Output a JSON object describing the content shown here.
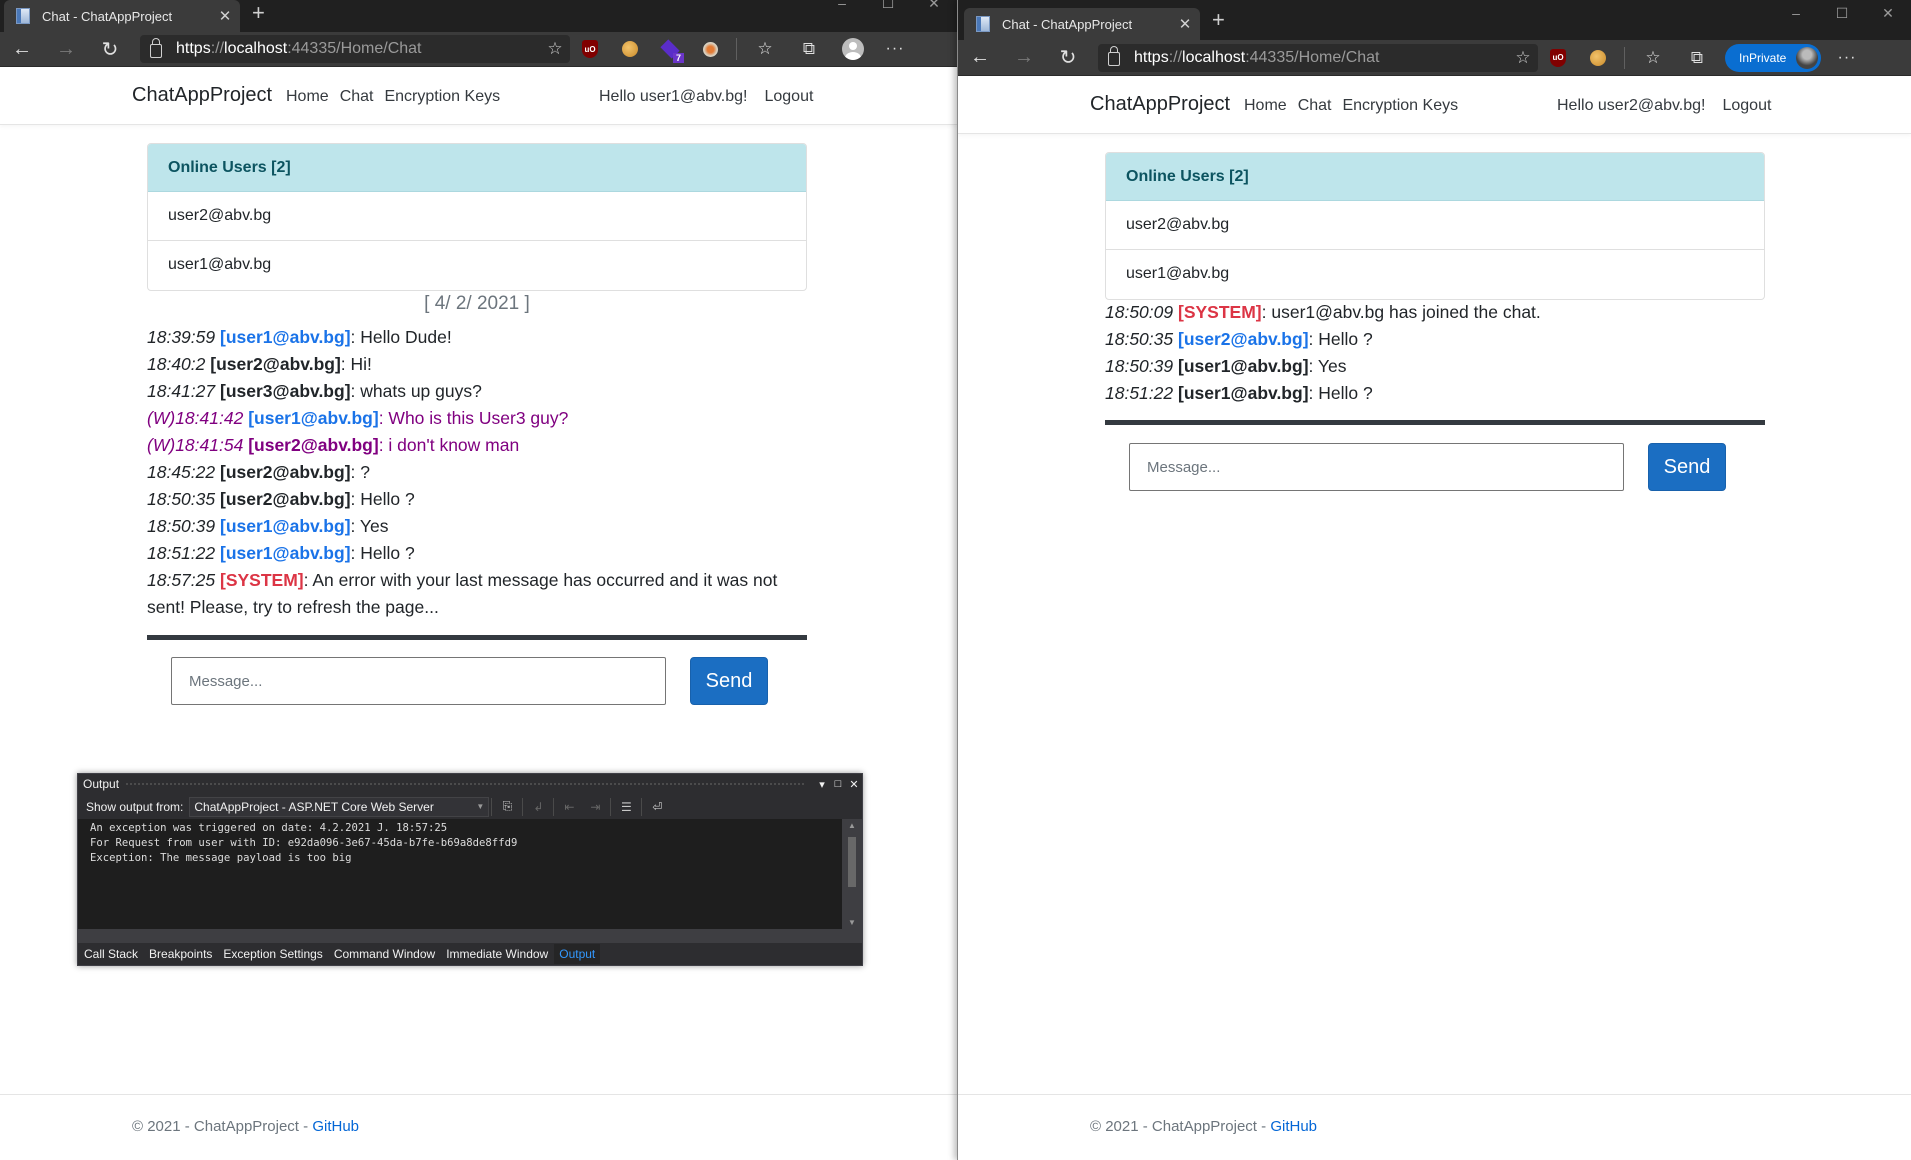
{
  "left_window": {
    "tab_title": "Chat - ChatAppProject",
    "url": {
      "scheme": "https",
      "sep": "://",
      "host": "localhost",
      "port": ":44335",
      "path": "/Home/Chat"
    },
    "extension_badge": "7",
    "brand": "ChatAppProject",
    "nav": [
      "Home",
      "Chat",
      "Encryption Keys"
    ],
    "greeting": "Hello user1@abv.bg!",
    "logout": "Logout",
    "online_header": "Online Users [2]",
    "online_users": [
      "user2@abv.bg",
      "user1@abv.bg"
    ],
    "date": "[ 4/ 2/ 2021 ]",
    "messages": [
      {
        "prefix": "",
        "time": "18:39:59",
        "user": "[user1@abv.bg]",
        "style": "blue",
        "text": ": Hello Dude!",
        "whisper": false
      },
      {
        "prefix": "",
        "time": "18:40:2",
        "user": "[user2@abv.bg]",
        "style": "dark",
        "text": ": Hi!",
        "whisper": false
      },
      {
        "prefix": "",
        "time": "18:41:27",
        "user": "[user3@abv.bg]",
        "style": "dark",
        "text": ": whats up guys?",
        "whisper": false
      },
      {
        "prefix": "(W)",
        "time": "18:41:42",
        "user": "[user1@abv.bg]",
        "style": "blue",
        "text": ": Who is this User3 guy?",
        "whisper": true
      },
      {
        "prefix": "(W)",
        "time": "18:41:54",
        "user": "[user2@abv.bg]",
        "style": "purple",
        "text": ": i don't know man",
        "whisper": true
      },
      {
        "prefix": "",
        "time": "18:45:22",
        "user": "[user2@abv.bg]",
        "style": "dark",
        "text": ": ?",
        "whisper": false
      },
      {
        "prefix": "",
        "time": "18:50:35",
        "user": "[user2@abv.bg]",
        "style": "dark",
        "text": ": Hello ?",
        "whisper": false
      },
      {
        "prefix": "",
        "time": "18:50:39",
        "user": "[user1@abv.bg]",
        "style": "blue",
        "text": ": Yes",
        "whisper": false
      },
      {
        "prefix": "",
        "time": "18:51:22",
        "user": "[user1@abv.bg]",
        "style": "blue",
        "text": ": Hello ?",
        "whisper": false
      },
      {
        "prefix": "",
        "time": "18:57:25",
        "user": "[SYSTEM]",
        "style": "red",
        "text": ": An error with your last message has occurred and it was not sent! Please, try to refresh the page...",
        "whisper": false
      }
    ],
    "message_placeholder": "Message...",
    "send_label": "Send",
    "footer_text": "© 2021 - ChatAppProject - ",
    "footer_link": "GitHub"
  },
  "right_window": {
    "tab_title": "Chat - ChatAppProject",
    "url": {
      "scheme": "https",
      "sep": "://",
      "host": "localhost",
      "port": ":44335",
      "path": "/Home/Chat"
    },
    "inprivate_label": "InPrivate",
    "brand": "ChatAppProject",
    "nav": [
      "Home",
      "Chat",
      "Encryption Keys"
    ],
    "greeting": "Hello user2@abv.bg!",
    "logout": "Logout",
    "online_header": "Online Users [2]",
    "online_users": [
      "user2@abv.bg",
      "user1@abv.bg"
    ],
    "messages": [
      {
        "prefix": "",
        "time": "18:50:09",
        "user": "[SYSTEM]",
        "style": "red",
        "text": ": user1@abv.bg has joined the chat.",
        "whisper": false
      },
      {
        "prefix": "",
        "time": "18:50:35",
        "user": "[user2@abv.bg]",
        "style": "blue",
        "text": ": Hello ?",
        "whisper": false
      },
      {
        "prefix": "",
        "time": "18:50:39",
        "user": "[user1@abv.bg]",
        "style": "dark",
        "text": ": Yes",
        "whisper": false
      },
      {
        "prefix": "",
        "time": "18:51:22",
        "user": "[user1@abv.bg]",
        "style": "dark",
        "text": ": Hello ?",
        "whisper": false
      }
    ],
    "message_placeholder": "Message...",
    "send_label": "Send",
    "footer_text": "© 2021 - ChatAppProject - ",
    "footer_link": "GitHub"
  },
  "output_panel": {
    "title": "Output",
    "show_from_label": "Show output from:",
    "source": "ChatAppProject - ASP.NET Core Web Server",
    "lines": [
      "An exception was triggered on date: 4.2.2021 J. 18:57:25",
      "For Request from user with ID: e92da096-3e67-45da-b7fe-b69a8de8ffd9",
      "Exception: The message payload is too big"
    ],
    "tabs": [
      "Call Stack",
      "Breakpoints",
      "Exception Settings",
      "Command Window",
      "Immediate Window",
      "Output"
    ],
    "active_tab": "Output"
  },
  "colors": {
    "accent_blue": "#1b6ec2",
    "user_blue": "#1a73e8",
    "system_red": "#dc3545",
    "whisper_purple": "#800080",
    "panel_header_bg": "#bee5eb",
    "inprivate_blue": "#0a6ed1"
  }
}
